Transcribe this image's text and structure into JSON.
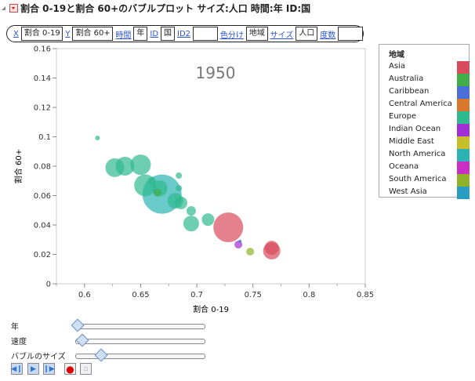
{
  "header": {
    "title": "割合 0-19と割合 60+のバブルプロット サイズ:人口 時間:年 ID:国"
  },
  "roles": [
    {
      "label": "X",
      "value": "割合 0-19"
    },
    {
      "label": "Y",
      "value": "割合 60+"
    },
    {
      "label": "時間",
      "value": "年"
    },
    {
      "label": "ID",
      "value": "国"
    },
    {
      "label": "ID2",
      "value": ""
    },
    {
      "label": "色分け",
      "value": "地域"
    },
    {
      "label": "サイズ",
      "value": "人口"
    },
    {
      "label": "度数",
      "value": ""
    }
  ],
  "chart_data": {
    "type": "scatter",
    "title": "",
    "annotation": "1950",
    "xlabel": "割合 0-19",
    "ylabel": "割合 60+",
    "xlim": [
      0.575,
      0.85
    ],
    "ylim": [
      0,
      0.16
    ],
    "xticks": [
      "0.6",
      "0.65",
      "0.7",
      "0.75",
      "0.8",
      "0.85"
    ],
    "yticks": [
      "0",
      "0.02",
      "0.04",
      "0.06",
      "0.08",
      "0.1",
      "0.12",
      "0.14",
      "0.16"
    ],
    "legend_title": "地域",
    "legend_placement": "right",
    "legend": [
      {
        "name": "Asia",
        "color": "#d84b5c"
      },
      {
        "name": "Australia",
        "color": "#3fae48"
      },
      {
        "name": "Caribbean",
        "color": "#4a6fd8"
      },
      {
        "name": "Central America",
        "color": "#d9782d"
      },
      {
        "name": "Europe",
        "color": "#2fb98e"
      },
      {
        "name": "Indian Ocean",
        "color": "#a22ed6"
      },
      {
        "name": "Middle East",
        "color": "#c7bf2a"
      },
      {
        "name": "North America",
        "color": "#2bb2b2"
      },
      {
        "name": "Oceana",
        "color": "#c92fc2"
      },
      {
        "name": "South America",
        "color": "#8fb22a"
      },
      {
        "name": "West Asia",
        "color": "#2a9ec2"
      }
    ],
    "points": [
      {
        "region": "North America",
        "x": 0.669,
        "y": 0.061,
        "size": 25
      },
      {
        "region": "Asia",
        "x": 0.728,
        "y": 0.0384,
        "size": 19
      },
      {
        "region": "Europe",
        "x": 0.627,
        "y": 0.079,
        "size": 12
      },
      {
        "region": "Europe",
        "x": 0.636,
        "y": 0.08,
        "size": 12
      },
      {
        "region": "Europe",
        "x": 0.65,
        "y": 0.081,
        "size": 13
      },
      {
        "region": "Europe",
        "x": 0.654,
        "y": 0.067,
        "size": 14
      },
      {
        "region": "Europe",
        "x": 0.667,
        "y": 0.065,
        "size": 10
      },
      {
        "region": "Europe",
        "x": 0.681,
        "y": 0.0565,
        "size": 10
      },
      {
        "region": "Europe",
        "x": 0.686,
        "y": 0.055,
        "size": 8
      },
      {
        "region": "Europe",
        "x": 0.695,
        "y": 0.041,
        "size": 10
      },
      {
        "region": "Europe",
        "x": 0.71,
        "y": 0.0437,
        "size": 8
      },
      {
        "region": "Europe",
        "x": 0.695,
        "y": 0.0496,
        "size": 6
      },
      {
        "region": "Europe",
        "x": 0.684,
        "y": 0.065,
        "size": 4
      },
      {
        "region": "Europe",
        "x": 0.684,
        "y": 0.0736,
        "size": 4
      },
      {
        "region": "Europe",
        "x": 0.6116,
        "y": 0.0992,
        "size": 3
      },
      {
        "region": "Europe",
        "x": 0.66,
        "y": 0.07,
        "size": 5
      },
      {
        "region": "Australia",
        "x": 0.665,
        "y": 0.062,
        "size": 5
      },
      {
        "region": "Asia",
        "x": 0.7667,
        "y": 0.0224,
        "size": 11
      },
      {
        "region": "Asia",
        "x": 0.7667,
        "y": 0.0245,
        "size": 9
      },
      {
        "region": "Indian Ocean",
        "x": 0.737,
        "y": 0.0267,
        "size": 5
      },
      {
        "region": "Caribbean",
        "x": 0.7385,
        "y": 0.029,
        "size": 2
      },
      {
        "region": "South America",
        "x": 0.7475,
        "y": 0.0219,
        "size": 5
      }
    ]
  },
  "controls": {
    "sliders": [
      {
        "label": "年",
        "value": 0
      },
      {
        "label": "速度",
        "value": 0.04
      },
      {
        "label": "バブルのサイズ",
        "value": 0.2
      }
    ],
    "buttons": [
      "step-back",
      "play",
      "step-forward",
      "record",
      "save"
    ]
  }
}
